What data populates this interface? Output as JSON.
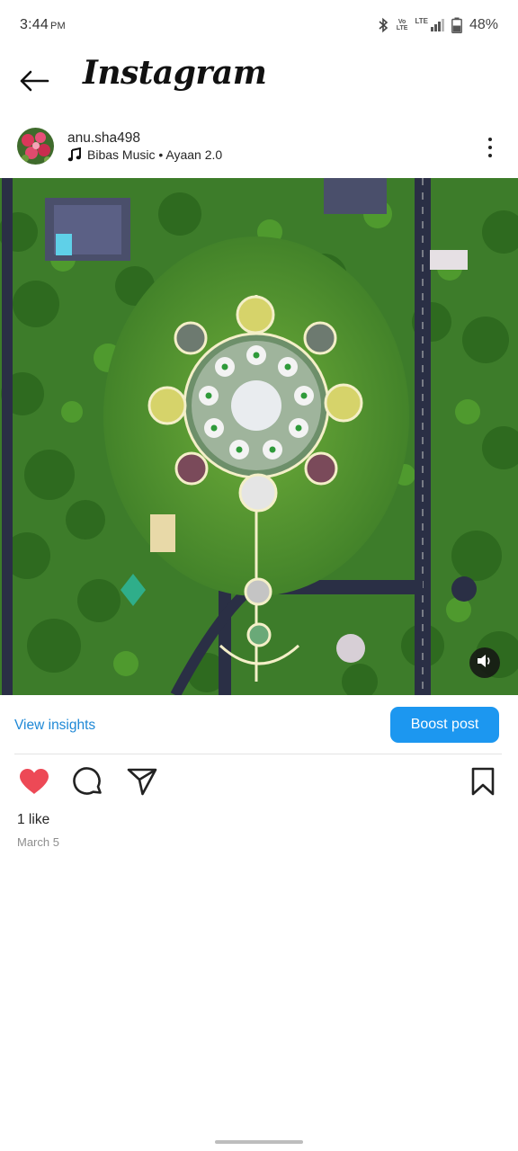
{
  "status_bar": {
    "time": "3:44",
    "ampm": "PM",
    "volte_top": "Vo",
    "volte_bottom": "LTE",
    "lte": "LTE",
    "battery": "48%"
  },
  "header": {
    "title": "Instagram",
    "back_icon": "arrow-left-icon"
  },
  "post": {
    "username": "anu.sha498",
    "music": "Bibas Music • Ayaan 2.0",
    "music_icon": "music-note-icon",
    "more_icon": "more-vertical-icon",
    "media_description_icon": "volume-icon"
  },
  "insights": {
    "view_label": "View insights",
    "boost_label": "Boost post",
    "accent": "#1c97f0"
  },
  "actions": {
    "like_icon": "heart-filled-icon",
    "comment_icon": "comment-icon",
    "share_icon": "send-icon",
    "save_icon": "bookmark-icon",
    "like_color": "#ed4956"
  },
  "likes_text": "1 like",
  "date_text": "March 5"
}
